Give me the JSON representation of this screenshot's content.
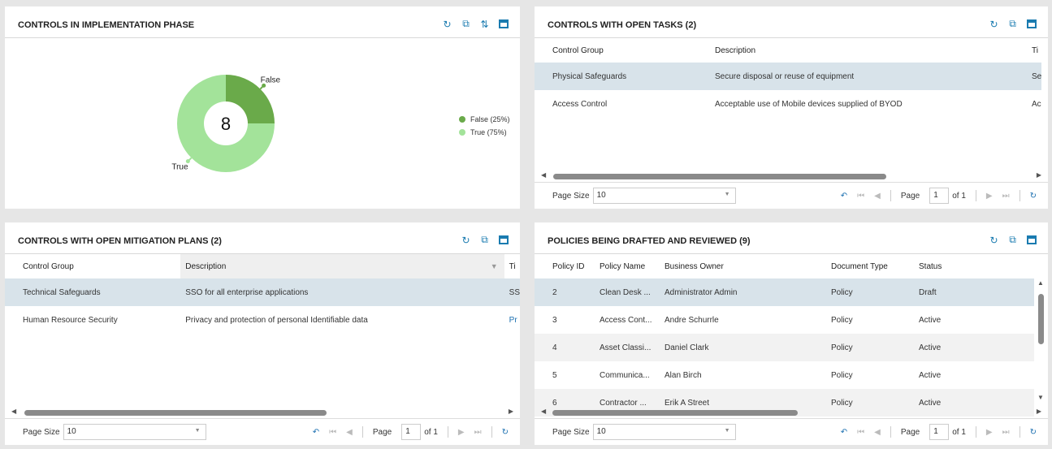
{
  "panels": {
    "impl": {
      "title": "CONTROLS IN IMPLEMENTATION PHASE"
    },
    "tasks": {
      "title": "CONTROLS WITH OPEN TASKS (2)",
      "columns": [
        "Control Group",
        "Description",
        "Ti"
      ],
      "rows": [
        [
          "Physical Safeguards",
          "Secure disposal or reuse of equipment",
          "Se"
        ],
        [
          "Access Control",
          "Acceptable use of Mobile devices supplied of BYOD",
          "Ac"
        ]
      ]
    },
    "mitig": {
      "title": "CONTROLS WITH OPEN MITIGATION PLANS (2)",
      "columns": [
        "Control Group",
        "Description",
        "Ti"
      ],
      "rows": [
        [
          "Technical Safeguards",
          "SSO for all enterprise applications",
          "SS"
        ],
        [
          "Human Resource Security",
          "Privacy and protection of personal Identifiable data",
          "Pr"
        ]
      ]
    },
    "policies": {
      "title": "POLICIES BEING DRAFTED AND REVIEWED (9)",
      "columns": [
        "Policy ID",
        "Policy Name",
        "Business Owner",
        "Document Type",
        "Status"
      ],
      "rows": [
        [
          "2",
          "Clean Desk ...",
          "Administrator Admin",
          "Policy",
          "Draft"
        ],
        [
          "3",
          "Access Cont...",
          "Andre Schurrle",
          "Policy",
          "Active"
        ],
        [
          "4",
          "Asset Classi...",
          "Daniel Clark",
          "Policy",
          "Active"
        ],
        [
          "5",
          "Communica...",
          "Alan Birch",
          "Policy",
          "Active"
        ],
        [
          "6",
          "Contractor ...",
          "Erik A Street",
          "Policy",
          "Active"
        ]
      ]
    }
  },
  "pager": {
    "page_size_label": "Page Size",
    "page_size": "10",
    "page_label": "Page",
    "page": "1",
    "of": "of 1"
  },
  "chart_data": {
    "type": "pie",
    "donut": true,
    "center_label": "8",
    "categories": [
      "False",
      "True"
    ],
    "values": [
      25,
      75
    ],
    "legend": [
      "False (25%)",
      "True (75%)"
    ],
    "colors": [
      "#6aaa4a",
      "#a3e39a"
    ],
    "legend_position": "right"
  },
  "icons": [
    "refresh-icon",
    "export-icon",
    "sort-icon",
    "maximize-icon"
  ]
}
